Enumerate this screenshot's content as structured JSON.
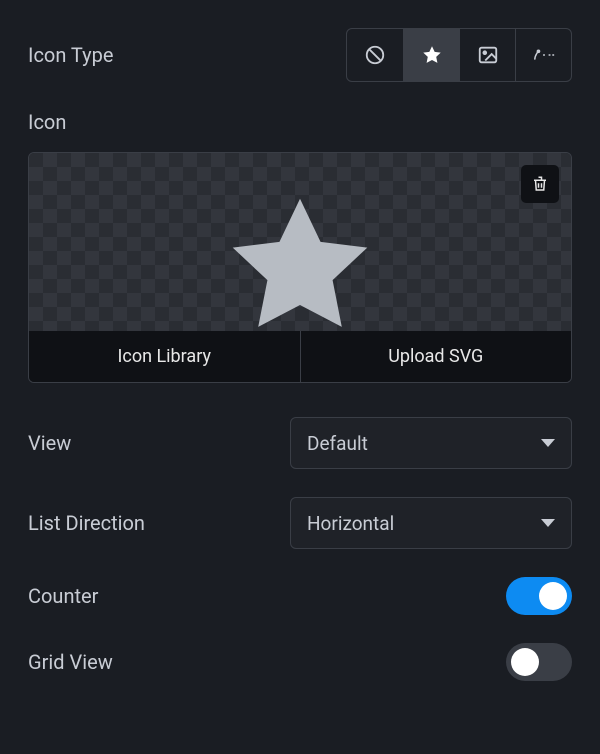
{
  "iconType": {
    "label": "Icon Type",
    "options": [
      "none",
      "icon",
      "image",
      "lottie"
    ],
    "selected": "icon"
  },
  "icon": {
    "label": "Icon",
    "libraryLabel": "Icon Library",
    "uploadLabel": "Upload SVG"
  },
  "view": {
    "label": "View",
    "value": "Default"
  },
  "listDirection": {
    "label": "List Direction",
    "value": "Horizontal"
  },
  "counter": {
    "label": "Counter",
    "value": true
  },
  "gridView": {
    "label": "Grid View",
    "value": false
  }
}
